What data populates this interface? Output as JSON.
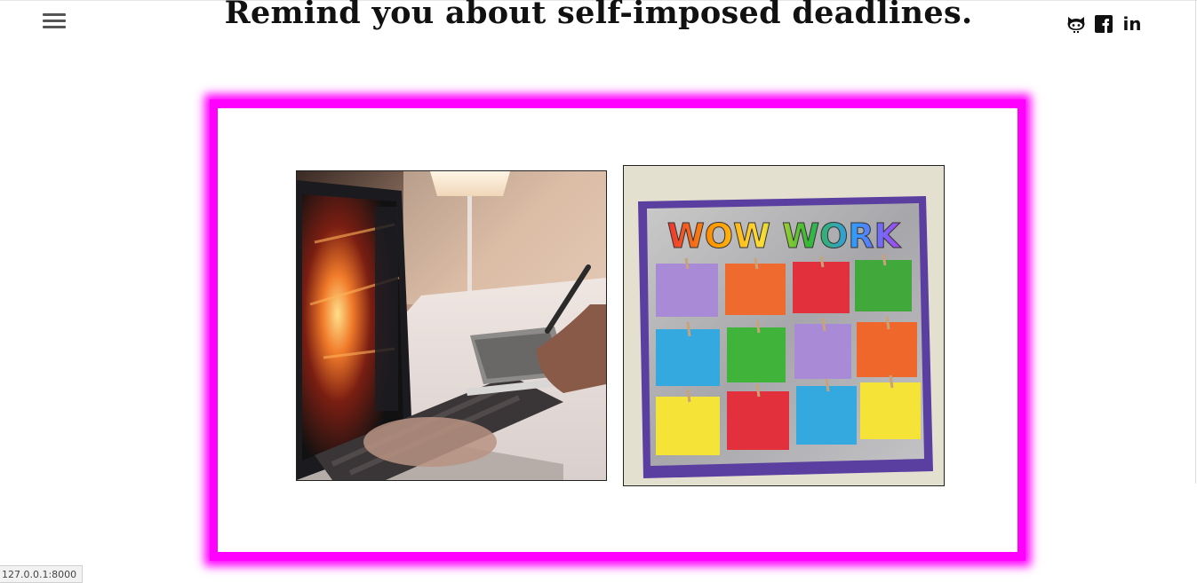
{
  "header": {
    "menu_icon": "hamburger-menu-icon",
    "headline": "Remind you about self-imposed deadlines."
  },
  "social": {
    "github_icon": "github-icon",
    "facebook_icon": "facebook-icon",
    "linkedin_icon": "linkedin-icon",
    "linkedin_text": "in"
  },
  "gallery": {
    "frame_color": "#ff00ff",
    "board_title": "WOW WORK"
  },
  "status_bar": {
    "url": "127.0.0.1:8000"
  }
}
